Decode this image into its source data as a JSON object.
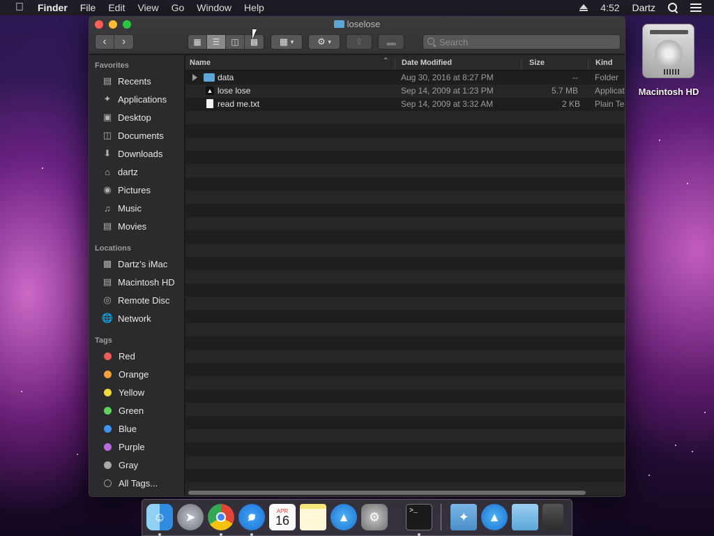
{
  "menubar": {
    "apple_icon": "apple-icon",
    "items": [
      "Finder",
      "File",
      "Edit",
      "View",
      "Go",
      "Window",
      "Help"
    ],
    "clock": "4:52",
    "user": "Dartz"
  },
  "window": {
    "title": "loselose",
    "search_placeholder": "Search",
    "view_modes": [
      "icon-view",
      "list-view",
      "column-view",
      "cover-flow-view"
    ],
    "selected_view": "list-view"
  },
  "sidebar": {
    "favorites_header": "Favorites",
    "favorites": [
      {
        "label": "Recents",
        "icon": "recents-icon"
      },
      {
        "label": "Applications",
        "icon": "applications-icon"
      },
      {
        "label": "Desktop",
        "icon": "desktop-icon"
      },
      {
        "label": "Documents",
        "icon": "documents-icon"
      },
      {
        "label": "Downloads",
        "icon": "downloads-icon"
      },
      {
        "label": "dartz",
        "icon": "home-icon"
      },
      {
        "label": "Pictures",
        "icon": "pictures-icon"
      },
      {
        "label": "Music",
        "icon": "music-icon"
      },
      {
        "label": "Movies",
        "icon": "movies-icon"
      }
    ],
    "locations_header": "Locations",
    "locations": [
      {
        "label": "Dartz’s iMac",
        "icon": "imac-icon"
      },
      {
        "label": "Macintosh HD",
        "icon": "disk-icon"
      },
      {
        "label": "Remote Disc",
        "icon": "disc-icon"
      },
      {
        "label": "Network",
        "icon": "network-icon"
      }
    ],
    "tags_header": "Tags",
    "tags": [
      {
        "label": "Red",
        "color": "#ee5a55"
      },
      {
        "label": "Orange",
        "color": "#f3a33a"
      },
      {
        "label": "Yellow",
        "color": "#f1d93a"
      },
      {
        "label": "Green",
        "color": "#5fd35a"
      },
      {
        "label": "Blue",
        "color": "#3c95f0"
      },
      {
        "label": "Purple",
        "color": "#b869e0"
      },
      {
        "label": "Gray",
        "color": "#a8a8a8"
      }
    ],
    "all_tags": "All Tags..."
  },
  "columns": {
    "name": "Name",
    "date": "Date Modified",
    "size": "Size",
    "kind": "Kind"
  },
  "files": [
    {
      "name": "data",
      "date": "Aug 30, 2016 at 8:27 PM",
      "size": "--",
      "kind": "Folder",
      "icon": "folder-icon"
    },
    {
      "name": "lose lose",
      "date": "Sep 14, 2009 at 1:23 PM",
      "size": "5.7 MB",
      "kind": "Applicat",
      "icon": "app-icon"
    },
    {
      "name": "read me.txt",
      "date": "Sep 14, 2009 at 3:32 AM",
      "size": "2 KB",
      "kind": "Plain Te",
      "icon": "text-file-icon"
    }
  ],
  "desktop": {
    "hd_label": "Macintosh HD"
  },
  "dock": {
    "calendar_month": "APR",
    "calendar_day": "16",
    "apps": [
      "finder-icon",
      "launchpad-icon",
      "chrome-icon",
      "safari-icon",
      "calendar-icon",
      "notes-icon",
      "app-store-icon",
      "system-preferences-icon",
      "terminal-icon",
      "applications-folder-icon",
      "app-store-downloads-icon",
      "documents-folder-icon",
      "trash-icon"
    ]
  }
}
